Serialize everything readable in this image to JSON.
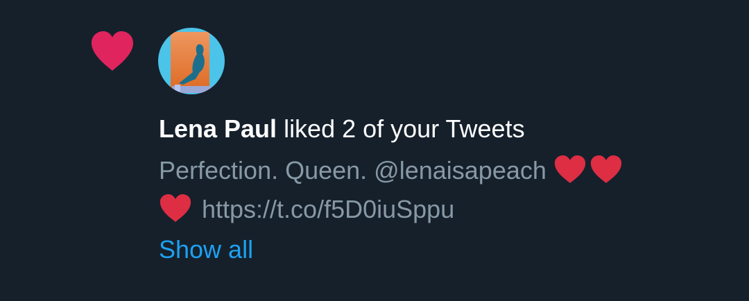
{
  "notification": {
    "icon": "heart-icon",
    "accent_color": "#e0245e",
    "avatar": {
      "alt": "profile-avatar"
    },
    "user_name": "Lena Paul",
    "action_text": " liked 2 of your Tweets",
    "tweet": {
      "text": "Perfection. Queen. @lenaisapeach ",
      "emoji": "red-heart-emoji",
      "link": " https://t.co/f5D0iuSppu"
    },
    "show_all_label": "Show all"
  },
  "colors": {
    "background": "#15202b",
    "primary_text": "#ffffff",
    "secondary_text": "#8899a6",
    "link": "#1da1f2",
    "heart": "#e0245e"
  }
}
